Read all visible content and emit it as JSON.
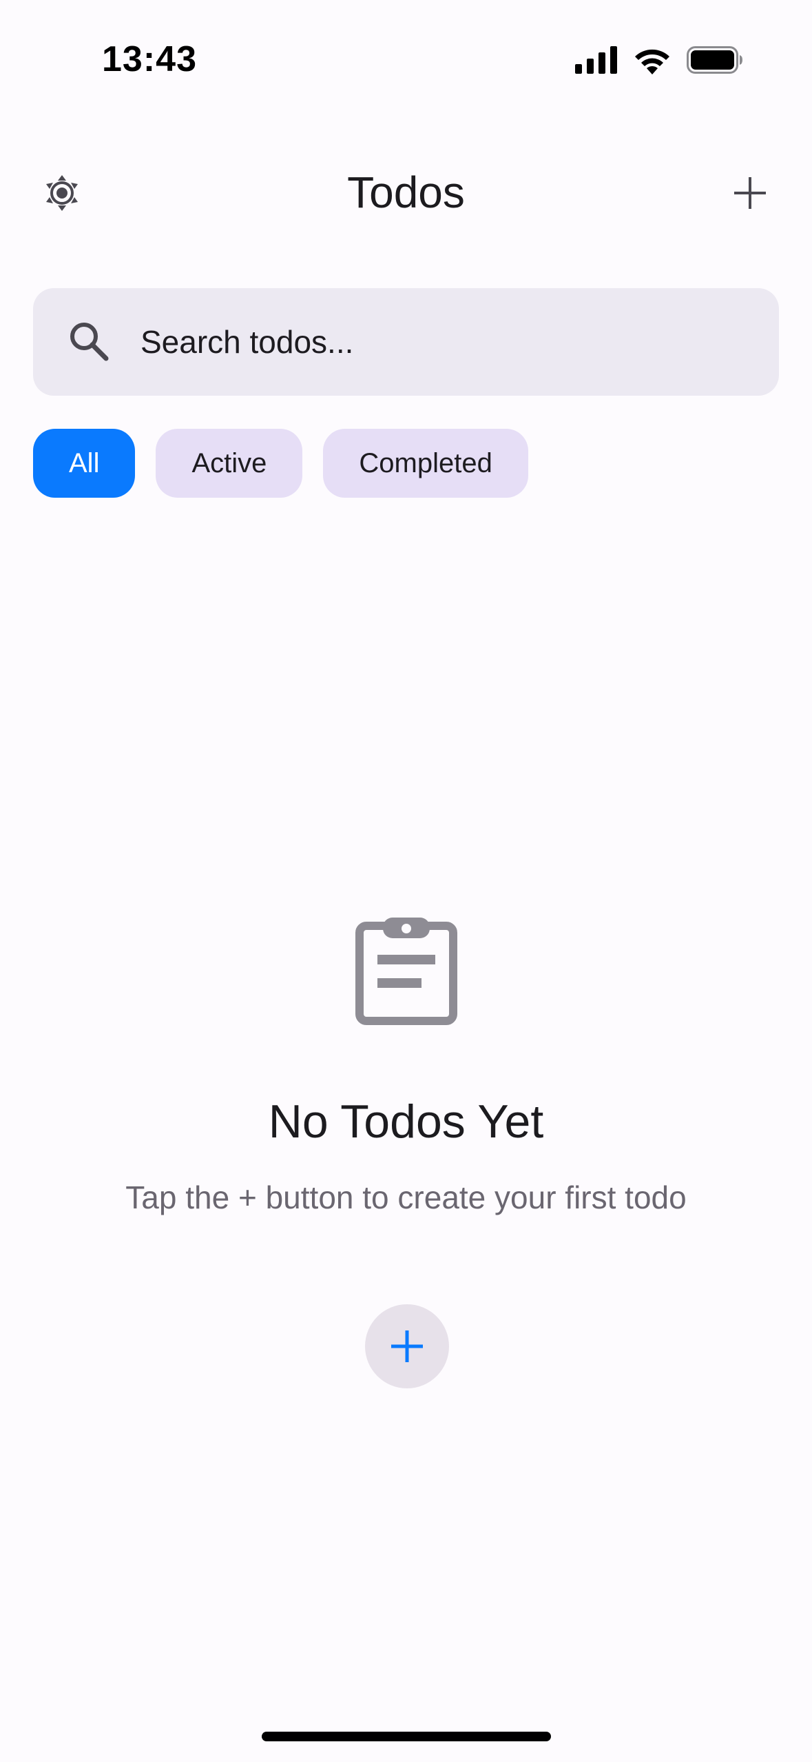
{
  "status_bar": {
    "time": "13:43",
    "icons": [
      "signal-icon",
      "wifi-icon",
      "battery-icon"
    ]
  },
  "header": {
    "title": "Todos",
    "left_icon": "brightness-icon",
    "right_icon": "plus-icon"
  },
  "search": {
    "placeholder": "Search todos...",
    "value": "",
    "icon": "search-icon"
  },
  "filters": [
    {
      "label": "All",
      "selected": true
    },
    {
      "label": "Active",
      "selected": false
    },
    {
      "label": "Completed",
      "selected": false
    }
  ],
  "empty_state": {
    "icon": "clipboard-icon",
    "title": "No Todos Yet",
    "subtitle": "Tap the + button to create your first todo"
  },
  "fab": {
    "icon": "plus-icon"
  },
  "colors": {
    "accent": "#0a7afe",
    "background": "#fdfbfe",
    "search_bg": "#ece9f2",
    "chip_bg": "#e6def6",
    "icon_gray": "#8e8c94"
  }
}
